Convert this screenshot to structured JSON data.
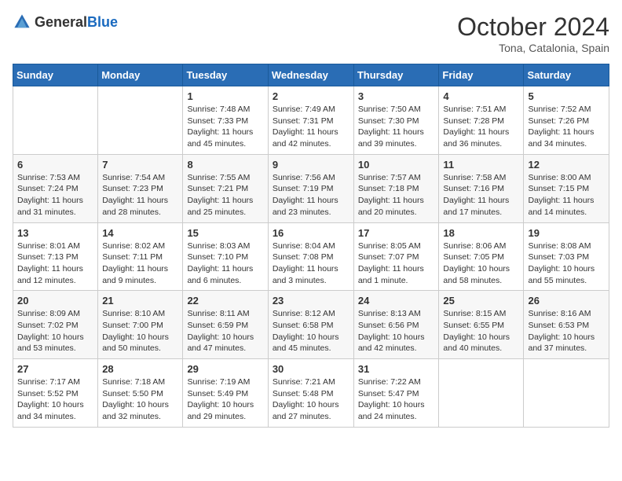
{
  "header": {
    "logo_general": "General",
    "logo_blue": "Blue",
    "month_title": "October 2024",
    "location": "Tona, Catalonia, Spain"
  },
  "days_of_week": [
    "Sunday",
    "Monday",
    "Tuesday",
    "Wednesday",
    "Thursday",
    "Friday",
    "Saturday"
  ],
  "weeks": [
    {
      "days": [
        {
          "num": "",
          "info": ""
        },
        {
          "num": "",
          "info": ""
        },
        {
          "num": "1",
          "info": "Sunrise: 7:48 AM\nSunset: 7:33 PM\nDaylight: 11 hours and 45 minutes."
        },
        {
          "num": "2",
          "info": "Sunrise: 7:49 AM\nSunset: 7:31 PM\nDaylight: 11 hours and 42 minutes."
        },
        {
          "num": "3",
          "info": "Sunrise: 7:50 AM\nSunset: 7:30 PM\nDaylight: 11 hours and 39 minutes."
        },
        {
          "num": "4",
          "info": "Sunrise: 7:51 AM\nSunset: 7:28 PM\nDaylight: 11 hours and 36 minutes."
        },
        {
          "num": "5",
          "info": "Sunrise: 7:52 AM\nSunset: 7:26 PM\nDaylight: 11 hours and 34 minutes."
        }
      ]
    },
    {
      "days": [
        {
          "num": "6",
          "info": "Sunrise: 7:53 AM\nSunset: 7:24 PM\nDaylight: 11 hours and 31 minutes."
        },
        {
          "num": "7",
          "info": "Sunrise: 7:54 AM\nSunset: 7:23 PM\nDaylight: 11 hours and 28 minutes."
        },
        {
          "num": "8",
          "info": "Sunrise: 7:55 AM\nSunset: 7:21 PM\nDaylight: 11 hours and 25 minutes."
        },
        {
          "num": "9",
          "info": "Sunrise: 7:56 AM\nSunset: 7:19 PM\nDaylight: 11 hours and 23 minutes."
        },
        {
          "num": "10",
          "info": "Sunrise: 7:57 AM\nSunset: 7:18 PM\nDaylight: 11 hours and 20 minutes."
        },
        {
          "num": "11",
          "info": "Sunrise: 7:58 AM\nSunset: 7:16 PM\nDaylight: 11 hours and 17 minutes."
        },
        {
          "num": "12",
          "info": "Sunrise: 8:00 AM\nSunset: 7:15 PM\nDaylight: 11 hours and 14 minutes."
        }
      ]
    },
    {
      "days": [
        {
          "num": "13",
          "info": "Sunrise: 8:01 AM\nSunset: 7:13 PM\nDaylight: 11 hours and 12 minutes."
        },
        {
          "num": "14",
          "info": "Sunrise: 8:02 AM\nSunset: 7:11 PM\nDaylight: 11 hours and 9 minutes."
        },
        {
          "num": "15",
          "info": "Sunrise: 8:03 AM\nSunset: 7:10 PM\nDaylight: 11 hours and 6 minutes."
        },
        {
          "num": "16",
          "info": "Sunrise: 8:04 AM\nSunset: 7:08 PM\nDaylight: 11 hours and 3 minutes."
        },
        {
          "num": "17",
          "info": "Sunrise: 8:05 AM\nSunset: 7:07 PM\nDaylight: 11 hours and 1 minute."
        },
        {
          "num": "18",
          "info": "Sunrise: 8:06 AM\nSunset: 7:05 PM\nDaylight: 10 hours and 58 minutes."
        },
        {
          "num": "19",
          "info": "Sunrise: 8:08 AM\nSunset: 7:03 PM\nDaylight: 10 hours and 55 minutes."
        }
      ]
    },
    {
      "days": [
        {
          "num": "20",
          "info": "Sunrise: 8:09 AM\nSunset: 7:02 PM\nDaylight: 10 hours and 53 minutes."
        },
        {
          "num": "21",
          "info": "Sunrise: 8:10 AM\nSunset: 7:00 PM\nDaylight: 10 hours and 50 minutes."
        },
        {
          "num": "22",
          "info": "Sunrise: 8:11 AM\nSunset: 6:59 PM\nDaylight: 10 hours and 47 minutes."
        },
        {
          "num": "23",
          "info": "Sunrise: 8:12 AM\nSunset: 6:58 PM\nDaylight: 10 hours and 45 minutes."
        },
        {
          "num": "24",
          "info": "Sunrise: 8:13 AM\nSunset: 6:56 PM\nDaylight: 10 hours and 42 minutes."
        },
        {
          "num": "25",
          "info": "Sunrise: 8:15 AM\nSunset: 6:55 PM\nDaylight: 10 hours and 40 minutes."
        },
        {
          "num": "26",
          "info": "Sunrise: 8:16 AM\nSunset: 6:53 PM\nDaylight: 10 hours and 37 minutes."
        }
      ]
    },
    {
      "days": [
        {
          "num": "27",
          "info": "Sunrise: 7:17 AM\nSunset: 5:52 PM\nDaylight: 10 hours and 34 minutes."
        },
        {
          "num": "28",
          "info": "Sunrise: 7:18 AM\nSunset: 5:50 PM\nDaylight: 10 hours and 32 minutes."
        },
        {
          "num": "29",
          "info": "Sunrise: 7:19 AM\nSunset: 5:49 PM\nDaylight: 10 hours and 29 minutes."
        },
        {
          "num": "30",
          "info": "Sunrise: 7:21 AM\nSunset: 5:48 PM\nDaylight: 10 hours and 27 minutes."
        },
        {
          "num": "31",
          "info": "Sunrise: 7:22 AM\nSunset: 5:47 PM\nDaylight: 10 hours and 24 minutes."
        },
        {
          "num": "",
          "info": ""
        },
        {
          "num": "",
          "info": ""
        }
      ]
    }
  ]
}
